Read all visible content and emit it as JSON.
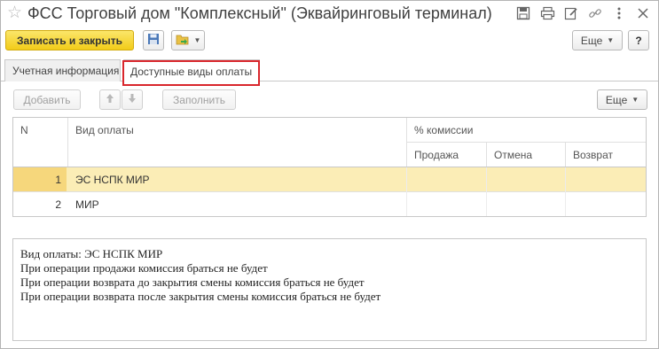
{
  "window": {
    "title": "ФСС Торговый дом \"Комплексный\" (Эквайринговый терминал)"
  },
  "title_icons": [
    "save-icon",
    "print-icon",
    "edit-icon",
    "link-icon",
    "more-vertical-icon",
    "close-icon"
  ],
  "toolbar": {
    "save_close_label": "Записать и закрыть",
    "more_label": "Еще",
    "help_label": "?"
  },
  "tabs": [
    {
      "label": "Учетная информация"
    },
    {
      "label": "Доступные виды оплаты"
    }
  ],
  "inner_toolbar": {
    "add_label": "Добавить",
    "fill_label": "Заполнить",
    "more_label": "Еще"
  },
  "table": {
    "headers": {
      "n": "N",
      "payment_type": "Вид оплаты",
      "commission": "% комиссии",
      "sale": "Продажа",
      "cancel": "Отмена",
      "return": "Возврат"
    },
    "rows": [
      {
        "n": "1",
        "name": "ЭС НСПК МИР"
      },
      {
        "n": "2",
        "name": "МИР"
      }
    ]
  },
  "description": {
    "lines": [
      "Вид оплаты: ЭС НСПК МИР",
      "При операции продажи комиссия браться не будет",
      "При операции возврата до закрытия смены комиссия браться не будет",
      "При операции возврата после закрытия смены комиссия браться не будет"
    ]
  },
  "colors": {
    "primary_button": "#f5d21f",
    "selected_row": "#fbedb6",
    "highlight_frame": "#d9262c"
  }
}
